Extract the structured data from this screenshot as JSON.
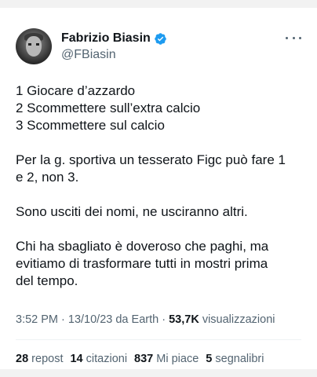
{
  "author": {
    "display_name": "Fabrizio Biasin",
    "handle": "@FBiasin",
    "verified": true,
    "verified_color": "#1d9bf0"
  },
  "menu_icon": "more-horizontal-icon",
  "tweet": {
    "lines_group_1": [
      "1 Giocare d’azzardo",
      "2 Scommettere sull’extra calcio",
      "3 Scommettere sul calcio"
    ],
    "paragraph_2_line_1": "Per la g. sportiva un tesserato Figc può fare 1",
    "paragraph_2_line_2": "e 2, non 3.",
    "paragraph_3": "Sono usciti dei nomi, ne usciranno altri.",
    "paragraph_4_line_1": "Chi ha sbagliato è doveroso che paghi, ma",
    "paragraph_4_line_2": "evitiamo di trasformare tutti in mostri prima",
    "paragraph_4_line_3": "del tempo."
  },
  "meta": {
    "time": "3:52 PM",
    "separator_1": " · ",
    "date": "13/10/23",
    "source_prefix": " da ",
    "source": "Earth",
    "separator_2": " · ",
    "views_count": "53,7K",
    "views_label": " visualizzazioni"
  },
  "stats": [
    {
      "count": "28",
      "label": "repost"
    },
    {
      "count": "14",
      "label": "citazioni"
    },
    {
      "count": "837",
      "label": "Mi piace"
    },
    {
      "count": "5",
      "label": "segnalibri"
    }
  ]
}
